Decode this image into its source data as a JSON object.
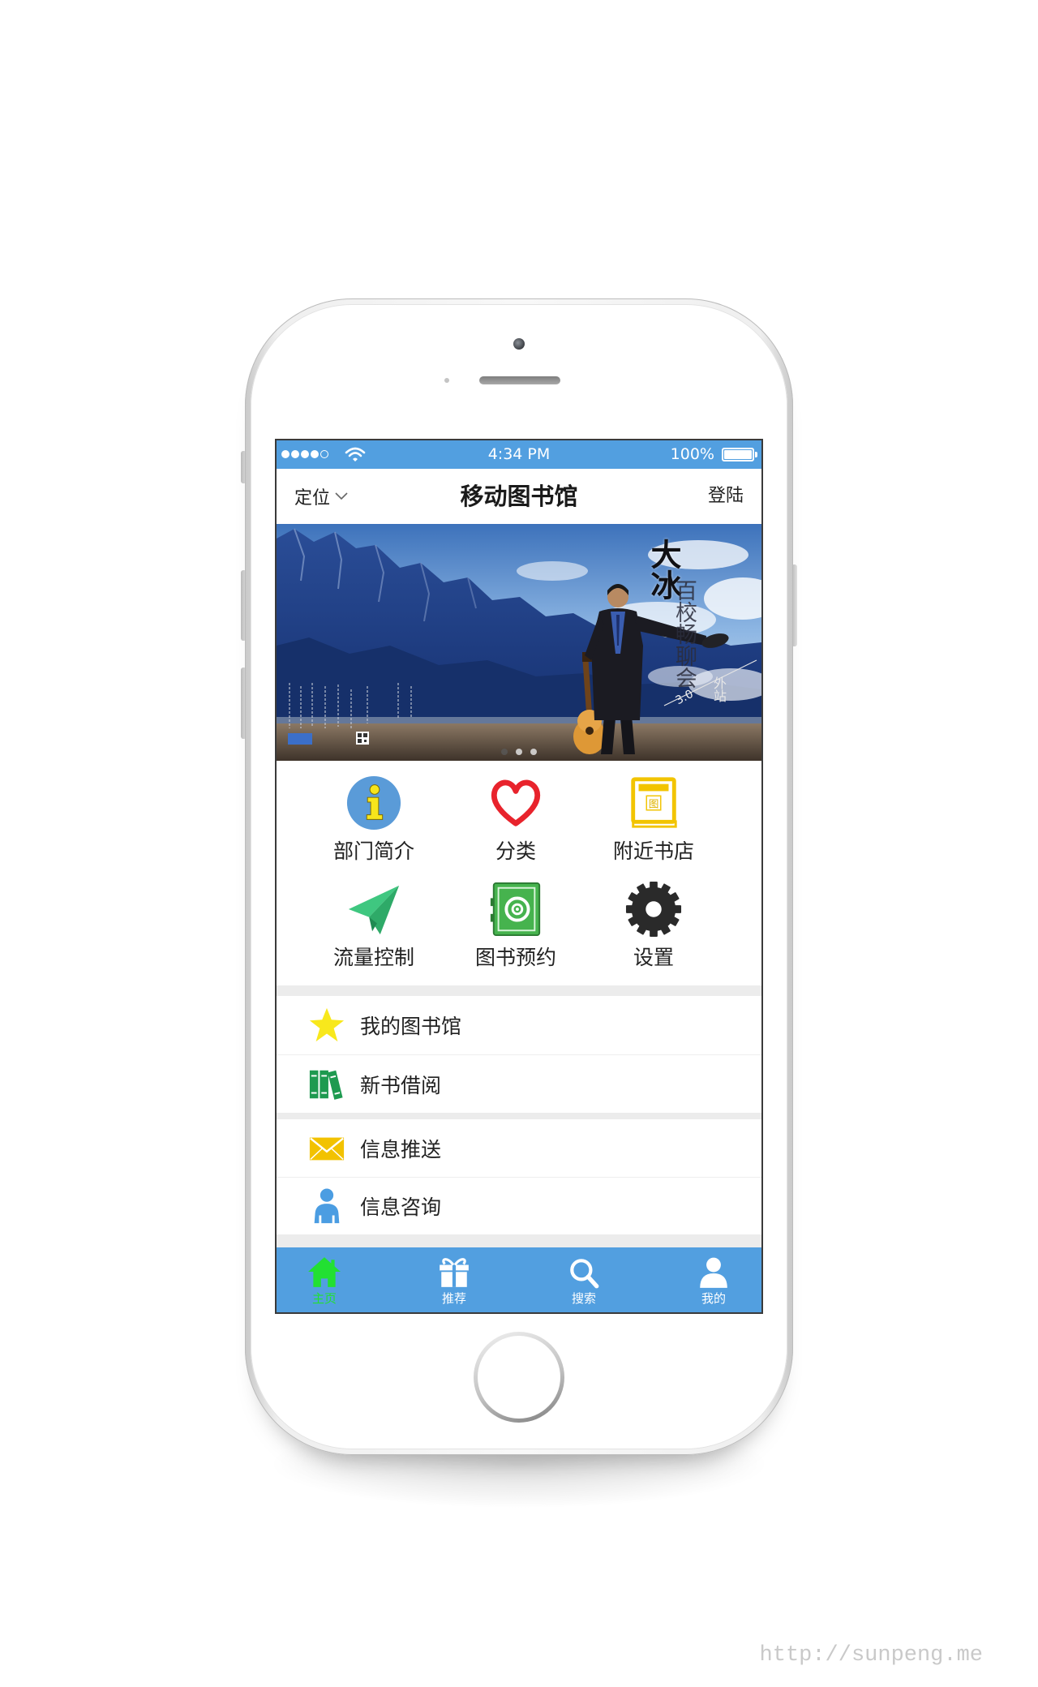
{
  "status_bar": {
    "signal_strength": 4,
    "signal_max": 5,
    "time": "4:34 PM",
    "battery_text": "100%",
    "battery_level": 1
  },
  "header": {
    "location_label": "定位",
    "title": "移动图书馆",
    "login_label": "登陆"
  },
  "banner": {
    "headline": "大冰",
    "subtitle": "百校畅聊会",
    "edition": "3.0",
    "tag": "外站",
    "slide_count": 3,
    "active_slide": 0
  },
  "grid": [
    {
      "label": "部门简介",
      "icon": "info-icon"
    },
    {
      "label": "分类",
      "icon": "heart-icon"
    },
    {
      "label": "附近书店",
      "icon": "bookstore-icon",
      "icon_text": "图"
    },
    {
      "label": "流量控制",
      "icon": "paper-plane-icon"
    },
    {
      "label": "图书预约",
      "icon": "safe-icon"
    },
    {
      "label": "设置",
      "icon": "gear-icon"
    }
  ],
  "list_groups": [
    {
      "items": [
        {
          "label": "我的图书馆",
          "icon": "star-icon"
        },
        {
          "label": "新书借阅",
          "icon": "books-icon"
        }
      ]
    },
    {
      "items": [
        {
          "label": "信息推送",
          "icon": "envelope-icon"
        },
        {
          "label": "信息咨询",
          "icon": "person-icon"
        }
      ]
    }
  ],
  "tab_bar": {
    "items": [
      {
        "label": "主页",
        "icon": "home-icon",
        "active": true
      },
      {
        "label": "推荐",
        "icon": "gift-icon",
        "active": false
      },
      {
        "label": "搜索",
        "icon": "search-icon",
        "active": false
      },
      {
        "label": "我的",
        "icon": "user-icon",
        "active": false
      }
    ]
  },
  "colors": {
    "bar_blue": "#529fe0",
    "active_green": "#22e032",
    "separator": "#ececec",
    "text": "#222222"
  },
  "watermark": "http://sunpeng.me"
}
